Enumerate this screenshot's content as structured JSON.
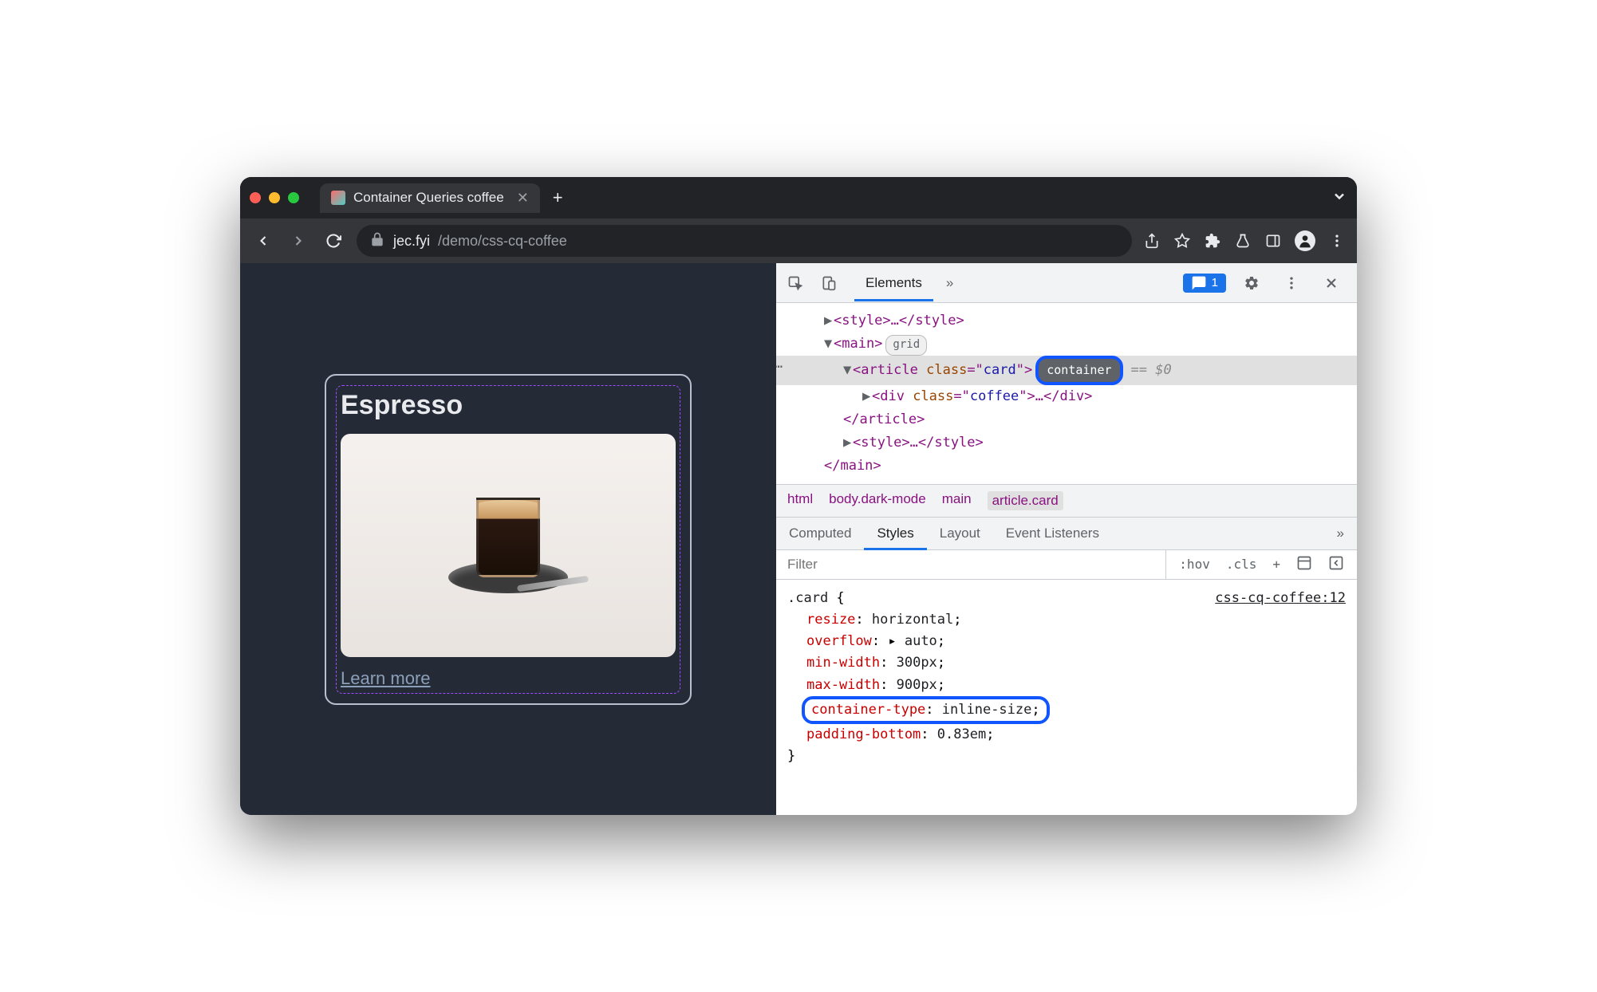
{
  "window": {
    "tab_title": "Container Queries coffee",
    "url_domain": "jec.fyi",
    "url_path": "/demo/css-cq-coffee"
  },
  "page": {
    "card_title": "Espresso",
    "learn_more_label": "Learn more"
  },
  "devtools": {
    "header": {
      "active_tab": "Elements",
      "issues_count": "1"
    },
    "dom": {
      "style_tag": "<style>…</style>",
      "main_open": "<main>",
      "main_badge": "grid",
      "article_open_1": "<article ",
      "article_attr_name": "class",
      "article_attr_val": "card",
      "article_open_2": ">",
      "container_badge": "container",
      "eq_dollar": "== $0",
      "div_open_1": "<div ",
      "div_attr_name": "class",
      "div_attr_val": "coffee",
      "div_open_2": ">…</div>",
      "article_close": "</article>",
      "style2": "<style>…</style>",
      "main_close": "</main>"
    },
    "breadcrumb": [
      "html",
      "body.dark-mode",
      "main",
      "article.card"
    ],
    "styles_tabs": [
      "Computed",
      "Styles",
      "Layout",
      "Event Listeners"
    ],
    "filter_placeholder": "Filter",
    "filter_btns": [
      ":hov",
      ".cls",
      "+"
    ],
    "rule": {
      "selector": ".card",
      "source": "css-cq-coffee:12",
      "props": [
        {
          "name": "resize",
          "value": "horizontal"
        },
        {
          "name": "overflow",
          "value": "auto",
          "expand": true
        },
        {
          "name": "min-width",
          "value": "300px"
        },
        {
          "name": "max-width",
          "value": "900px"
        },
        {
          "name": "container-type",
          "value": "inline-size",
          "highlighted": true
        },
        {
          "name": "padding-bottom",
          "value": "0.83em"
        }
      ]
    }
  }
}
